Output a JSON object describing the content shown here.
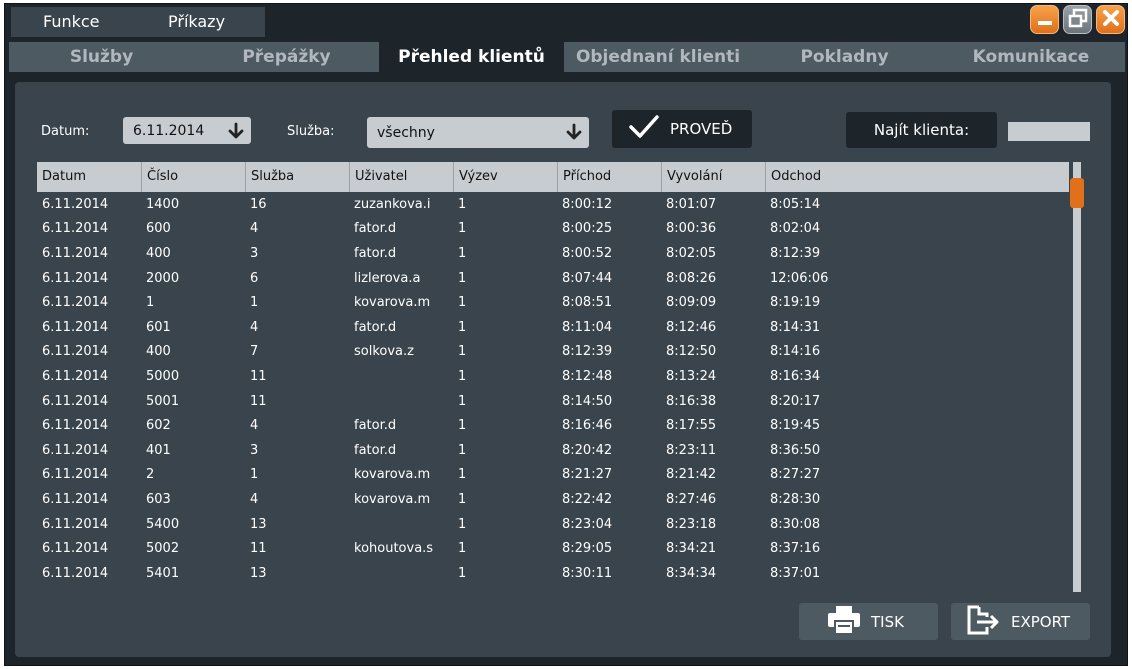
{
  "menu": {
    "items": [
      "Funkce",
      "Příkazy"
    ]
  },
  "tabs": [
    "Služby",
    "Přepážky",
    "Přehled klientů",
    "Objednaní klienti",
    "Pokladny",
    "Komunikace"
  ],
  "active_tab": "Přehled klientů",
  "filters": {
    "date_label": "Datum:",
    "date_value": "6.11.2014",
    "service_label": "Služba:",
    "service_value": "všechny",
    "run_label": "PROVEĎ",
    "find_label": "Najít klienta:",
    "find_value": ""
  },
  "table": {
    "columns": [
      "Datum",
      "Číslo",
      "Služba",
      "Uživatel",
      "Výzev",
      "Příchod",
      "Vyvolání",
      "Odchod"
    ],
    "rows": [
      [
        "6.11.2014",
        "1400",
        "16",
        "zuzankova.i",
        "1",
        "8:00:12",
        "8:01:07",
        "8:05:14"
      ],
      [
        "6.11.2014",
        "600",
        "4",
        "fator.d",
        "1",
        "8:00:25",
        "8:00:36",
        "8:02:04"
      ],
      [
        "6.11.2014",
        "400",
        "3",
        "fator.d",
        "1",
        "8:00:52",
        "8:02:05",
        "8:12:39"
      ],
      [
        "6.11.2014",
        "2000",
        "6",
        "lizlerova.a",
        "1",
        "8:07:44",
        "8:08:26",
        "12:06:06"
      ],
      [
        "6.11.2014",
        "1",
        "1",
        "kovarova.m",
        "1",
        "8:08:51",
        "8:09:09",
        "8:19:19"
      ],
      [
        "6.11.2014",
        "601",
        "4",
        "fator.d",
        "1",
        "8:11:04",
        "8:12:46",
        "8:14:31"
      ],
      [
        "6.11.2014",
        "400",
        "7",
        "solkova.z",
        "1",
        "8:12:39",
        "8:12:50",
        "8:14:16"
      ],
      [
        "6.11.2014",
        "5000",
        "11",
        "",
        "1",
        "8:12:48",
        "8:13:24",
        "8:16:34"
      ],
      [
        "6.11.2014",
        "5001",
        "11",
        "",
        "1",
        "8:14:50",
        "8:16:38",
        "8:20:17"
      ],
      [
        "6.11.2014",
        "602",
        "4",
        "fator.d",
        "1",
        "8:16:46",
        "8:17:55",
        "8:19:45"
      ],
      [
        "6.11.2014",
        "401",
        "3",
        "fator.d",
        "1",
        "8:20:42",
        "8:23:11",
        "8:36:50"
      ],
      [
        "6.11.2014",
        "2",
        "1",
        "kovarova.m",
        "1",
        "8:21:27",
        "8:21:42",
        "8:27:27"
      ],
      [
        "6.11.2014",
        "603",
        "4",
        "kovarova.m",
        "1",
        "8:22:42",
        "8:27:46",
        "8:28:30"
      ],
      [
        "6.11.2014",
        "5400",
        "13",
        "",
        "1",
        "8:23:04",
        "8:23:18",
        "8:30:08"
      ],
      [
        "6.11.2014",
        "5002",
        "11",
        "kohoutova.s",
        "1",
        "8:29:05",
        "8:34:21",
        "8:37:16"
      ],
      [
        "6.11.2014",
        "5401",
        "13",
        "",
        "1",
        "8:30:11",
        "8:34:34",
        "8:37:01"
      ]
    ]
  },
  "footer": {
    "print_label": "TISK",
    "export_label": "EXPORT"
  },
  "icons": {
    "minimize": "minimize-icon",
    "restore": "restore-icon",
    "close": "close-icon",
    "dropdown": "arrow-down-icon",
    "run": "checkmark-icon",
    "print": "printer-icon",
    "export": "export-icon"
  },
  "colors": {
    "accent": "#e0701a",
    "background": "#1d252b",
    "panel": "#3a444c",
    "header": "#c7ccd0"
  }
}
